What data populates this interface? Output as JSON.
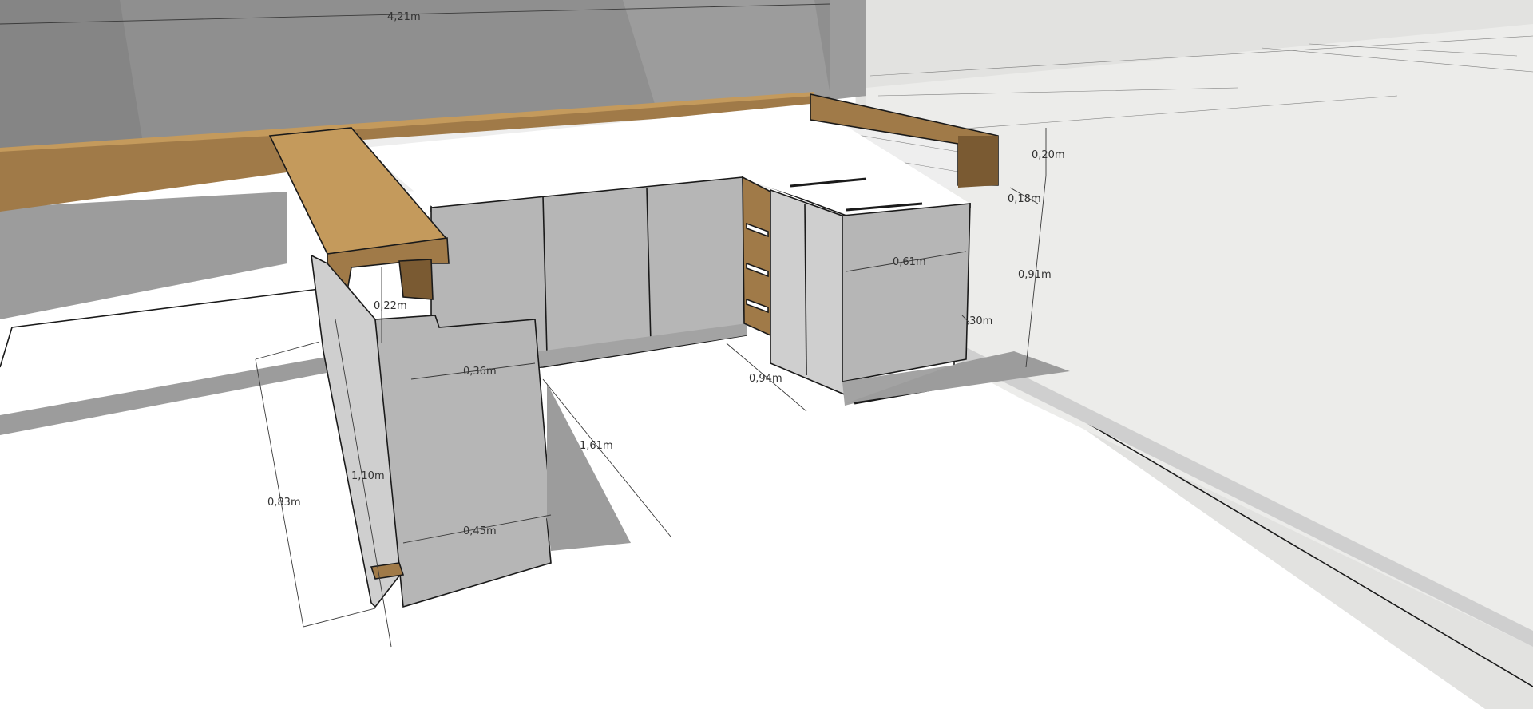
{
  "model": {
    "colors": {
      "wall": "#8f8f8f",
      "wall_dark": "#858585",
      "wall_light": "#9c9c9c",
      "floor": "#ffffff",
      "right_wall": "#e2e2e0",
      "right_floor": "#ececea",
      "wood": "#a07a48",
      "wood_light": "#c49a5c",
      "wood_dark": "#7a5a32",
      "cabinet": "#b6b6b6",
      "cabinet_dark": "#a3a3a3",
      "cabinet_light": "#cfcfcf",
      "tile": "#eeeeee",
      "counter_top": "#ffffff",
      "shadow": "#9c9c9c",
      "line": "#1a1a1a",
      "dim_line": "#3a3a3a"
    }
  },
  "dimensions": {
    "wall_length": "4,21m",
    "backsplash_height": "0,20m",
    "counter_depth_right": "0,18m",
    "counter_height": "0,91m",
    "right_cabinet_width": "0,61m",
    "right_offset": ",30m",
    "bar_top_height": "0,22m",
    "bar_upper_width": "0,36m",
    "corridor_depth": "0,94m",
    "island_length": "1,61m",
    "island_total_height": "1,10m",
    "island_side_height": "0,83m",
    "bar_lower_width": "0,45m"
  }
}
